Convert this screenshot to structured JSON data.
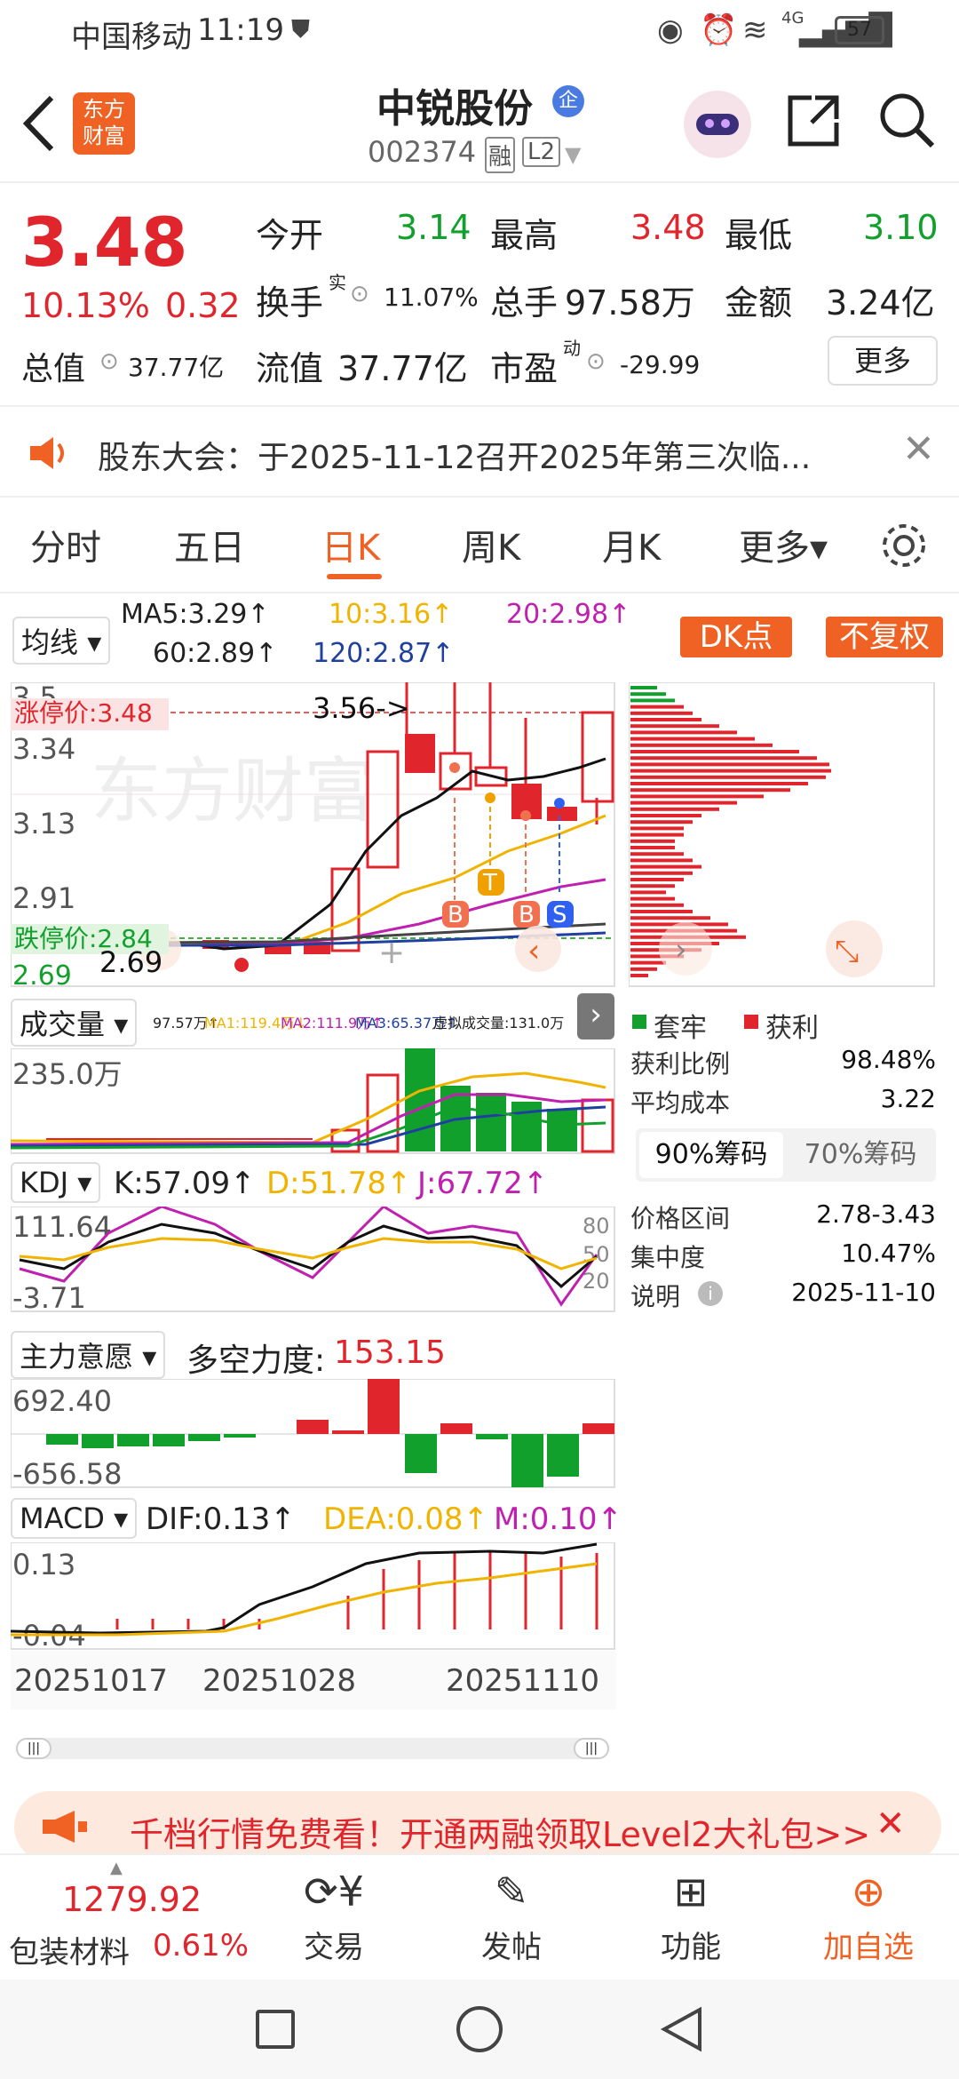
{
  "status_bar": {
    "carrier": "中国移动",
    "time": "11:19",
    "network": "4G",
    "battery": "57"
  },
  "header": {
    "logo_text": [
      "东方",
      "财富"
    ],
    "stock_name": "中锐股份",
    "badge": "企",
    "stock_code": "002374",
    "tag_margin": "融",
    "tag_level": "L2"
  },
  "quote": {
    "price": "3.48",
    "change_pct": "10.13%",
    "change": "0.32",
    "open_label": "今开",
    "open": "3.14",
    "high_label": "最高",
    "high": "3.48",
    "low_label": "最低",
    "low": "3.10",
    "turnover_label": "换手",
    "turnover_sup": "实",
    "turnover": "11.07%",
    "volume_label": "总手",
    "volume": "97.58万",
    "amount_label": "金额",
    "amount": "3.24亿",
    "mktcap_label": "总值",
    "mktcap": "37.77亿",
    "float_label": "流值",
    "float": "37.77亿",
    "pe_label": "市盈",
    "pe_sup": "动",
    "pe": "-29.99",
    "more_label": "更多"
  },
  "notice": {
    "text": "股东大会：于2025-11-12召开2025年第三次临..."
  },
  "tabs": [
    {
      "label": "分时"
    },
    {
      "label": "五日"
    },
    {
      "label": "日K"
    },
    {
      "label": "周K"
    },
    {
      "label": "月K"
    },
    {
      "label": "更多▾"
    }
  ],
  "ma": {
    "selector": "均线",
    "ma5": "MA5:3.29↑",
    "ma10": "10:3.16↑",
    "ma20": "20:2.98↑",
    "ma60": "60:2.89↑",
    "ma120": "120:2.87↑",
    "dk_label": "DK点",
    "fq_label": "不复权"
  },
  "kline": {
    "y_labels": [
      "3.5_",
      "3.34",
      "3.13",
      "2.91"
    ],
    "limit_up": "涨停价:3.48",
    "limit_down": "跌停价:2.84",
    "low_label": "2.69",
    "high_label": "3.56->",
    "bottom_label": "2.69",
    "markers": [
      "B",
      "T",
      "B",
      "S"
    ],
    "watermark": "东方财富"
  },
  "volume": {
    "selector": "成交量",
    "info": "97.57万↑",
    "ma1": "MA1:119.4万↓",
    "ma2": "MA2:111.9万↑",
    "ma3": "MA3:65.37万↑",
    "virtual": "虚拟成交量:131.0万",
    "ymax": "235.0万"
  },
  "kdj": {
    "selector": "KDJ",
    "k": "K:57.09↑",
    "d": "D:51.78↑",
    "j": "J:67.72↑",
    "ymax": "111.64",
    "ymin": "-3.71",
    "levels": [
      "80",
      "50",
      "20"
    ]
  },
  "zlyy": {
    "selector": "主力意愿",
    "label": "多空力度:",
    "value": "153.15",
    "ymax": "692.40",
    "ymin": "-656.58"
  },
  "macd": {
    "selector": "MACD",
    "dif": "DIF:0.13↑",
    "dea": "DEA:0.08↑",
    "m": "M:0.10↑",
    "ymax": "0.13",
    "ymin": "-0.04"
  },
  "dates": [
    "20251017",
    "20251028",
    "20251110"
  ],
  "chips": {
    "legend_trapped": "套牢",
    "legend_profit": "获利",
    "rows": [
      {
        "label": "获利比例",
        "value": "98.48%"
      },
      {
        "label": "平均成本",
        "value": "3.22"
      }
    ],
    "tab90": "90%筹码",
    "tab70": "70%筹码",
    "rows2": [
      {
        "label": "价格区间",
        "value": "2.78-3.43"
      },
      {
        "label": "集中度",
        "value": "10.47%"
      },
      {
        "label": "说明",
        "value": "2025-11-10"
      }
    ]
  },
  "promo": {
    "text": "千档行情免费看！开通两融领取Level2大礼包>>"
  },
  "bottom": {
    "index_value": "1279.92",
    "sector": "包装材料",
    "sector_pct": "0.61%",
    "nav": [
      "交易",
      "发帖",
      "功能",
      "加自选"
    ]
  },
  "colors": {
    "red": "#e0262c",
    "green": "#12a02c",
    "orange": "#f06224",
    "yellow": "#f0b400",
    "magenta": "#c020b0",
    "blue": "#2040a0"
  }
}
